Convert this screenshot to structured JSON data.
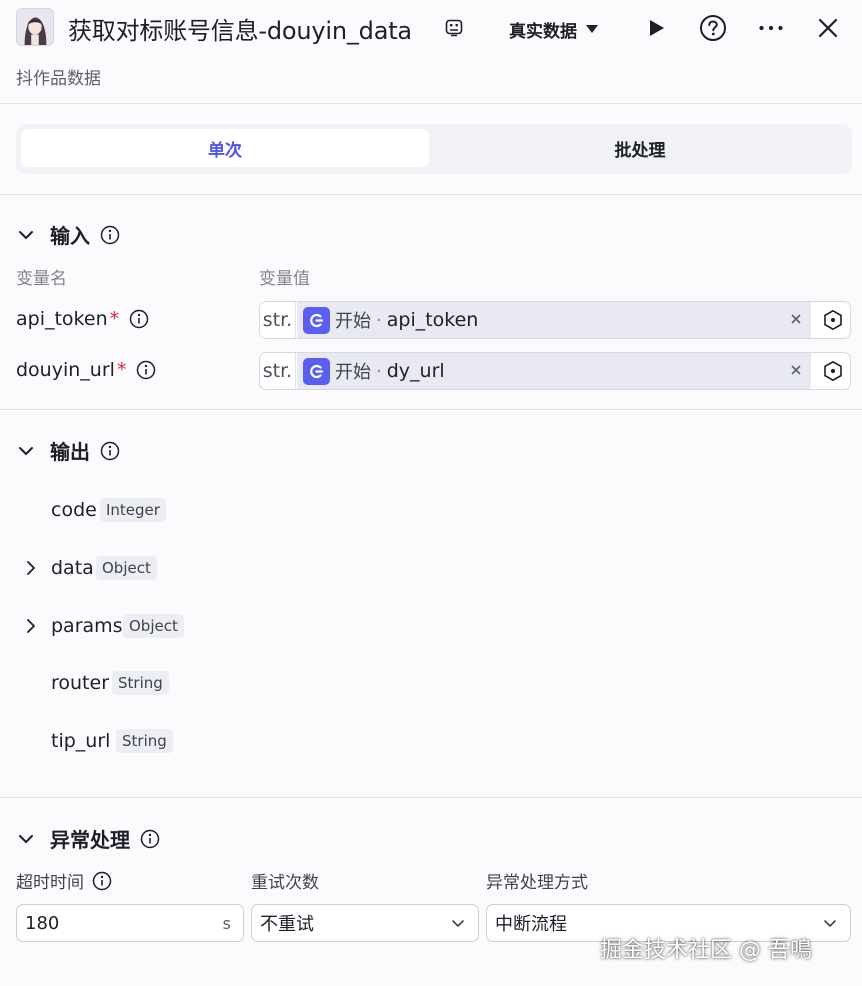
{
  "header": {
    "title": "获取对标账号信息-douyin_data",
    "mode_label": "真实数据",
    "subtitle": "抖作品数据"
  },
  "tabs": [
    {
      "label": "单次",
      "active": true
    },
    {
      "label": "批处理",
      "active": false
    }
  ],
  "input_section": {
    "title": "输入",
    "col_name": "变量名",
    "col_value": "变量值",
    "params": [
      {
        "name": "api_token",
        "required": true,
        "type": "str.",
        "node": "开始",
        "separator": "·",
        "ref": "api_token"
      },
      {
        "name": "douyin_url",
        "required": true,
        "type": "str.",
        "node": "开始",
        "separator": "·",
        "ref": "dy_url"
      }
    ]
  },
  "output_section": {
    "title": "输出",
    "fields": [
      {
        "name": "code",
        "type": "Integer",
        "expandable": false
      },
      {
        "name": "data",
        "type": "Object",
        "expandable": true
      },
      {
        "name": "params",
        "type": "Object",
        "expandable": true
      },
      {
        "name": "router",
        "type": "String",
        "expandable": false
      },
      {
        "name": "tip_url",
        "type": "String",
        "expandable": false
      }
    ]
  },
  "exception_section": {
    "title": "异常处理",
    "timeout_label": "超时时间",
    "retry_label": "重试次数",
    "handling_label": "异常处理方式",
    "timeout_value": "180",
    "timeout_unit": "s",
    "retry_value": "不重试",
    "handling_value": "中断流程"
  },
  "watermark": "掘金技术社区 @ 吾鳴",
  "colors": {
    "accent": "#4d53e8",
    "required": "#e0294a",
    "node_icon": "#5b5ff0"
  },
  "icons": [
    "edit-icon",
    "caret-down-icon",
    "play-icon",
    "help-icon",
    "more-icon",
    "close-icon",
    "info-icon",
    "chevron-down-icon",
    "chevron-right-icon",
    "start-node-icon",
    "clear-icon",
    "variable-picker-icon"
  ]
}
